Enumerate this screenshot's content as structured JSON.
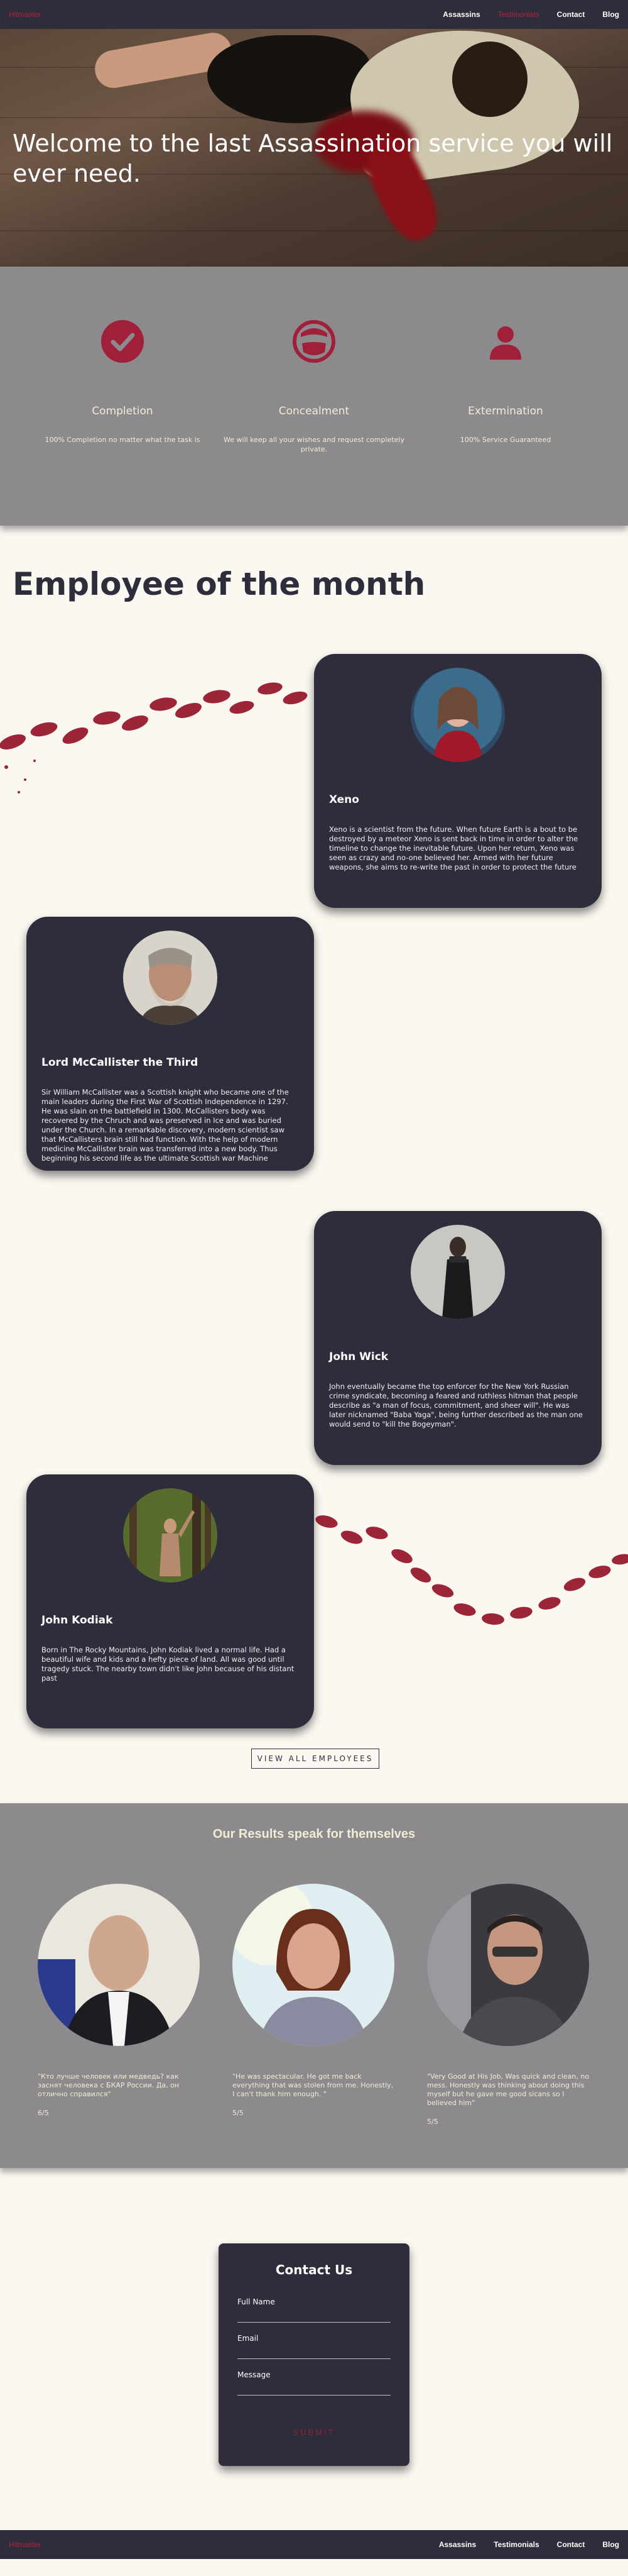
{
  "nav": {
    "brand": "Hitmaster",
    "links": [
      {
        "label": "Assassins"
      },
      {
        "label": "Testimonials"
      },
      {
        "label": "Contact"
      },
      {
        "label": "Blog"
      }
    ]
  },
  "hero": {
    "title": "Welcome to the last Assassination service you will ever need."
  },
  "features": [
    {
      "icon": "checkmark-circle-icon",
      "title": "Completion",
      "description": "100% Completion no matter what the task is"
    },
    {
      "icon": "masked-face-icon",
      "title": "Concealment",
      "description": "We will keep all your wishes and request completely private."
    },
    {
      "icon": "person-icon",
      "title": "Extermination",
      "description": "100% Service Guaranteed"
    }
  ],
  "employees": {
    "title": "Employee of the month",
    "cards": [
      {
        "name": "Xeno",
        "bio": "Xeno is a scientist from the future. When future Earth is a bout to be destroyed by a meteor Xeno is sent back in time in order to alter the timeline to change the inevitable future. Upon her return, Xeno was seen as crazy and no-one believed her. Armed with her future weapons, she aims to re-write the past in order to protect the future"
      },
      {
        "name": "Lord McCallister the Third",
        "bio": "Sir William McCallister was a Scottish knight who became one of the main leaders during the First War of Scottish Independence in 1297. He was slain on the battlefield in 1300. McCallisters body was recovered by the Chruch and was preserved in Ice and was buried under the Church. In a remarkable discovery, modern scientist saw that McCallisters brain still had function. With the help of modern medicine McCallister brain was transferred into a new body. Thus beginning his second life as the ultimate Scottish war Machine"
      },
      {
        "name": "John Wick",
        "bio": "John eventually became the top enforcer for the New York Russian crime syndicate, becoming a feared and ruthless hitman that people describe as \"a man of focus, commitment, and sheer will\". He was later nicknamed \"Baba Yaga\", being further described as the man one would send to \"kill the Bogeyman\"."
      },
      {
        "name": "John Kodiak",
        "bio": "Born in The Rocky Mountains, John Kodiak lived a normal life. Had a beautiful wife and kids and a hefty piece of land. All was good until tragedy stuck. The nearby town didn't like John because of his distant past"
      }
    ],
    "view_all_label": "VIEW ALL EMPLOYEES"
  },
  "results": {
    "title": "Our Results speak for themselves",
    "testimonials": [
      {
        "quote": "\"Кто лучше человек или медведь? как заснят человека с БКАР России. Да, он отлично справился\"",
        "rating": "6/5"
      },
      {
        "quote": "\"He was spectacular. He got me back everything that was stolen from me. Honestly, I can't thank him enough. \"",
        "rating": "5/5"
      },
      {
        "quote": "\"Very Good at His Job, Was quick and clean, no mess. Honestly was thinking about doing this myself but he gave me good sicans so I believed him\"",
        "rating": "5/5"
      }
    ]
  },
  "contact": {
    "title": "Contact Us",
    "fields": [
      {
        "label": "Full Name"
      },
      {
        "label": "Email"
      },
      {
        "label": "Message"
      }
    ],
    "submit_label": "SUBMIT"
  },
  "colors": {
    "navy": "#2e2d3b",
    "accent": "#b3243c",
    "gray": "#8c8a8d",
    "cream": "#f2ecd6",
    "background": "#fbf7f1"
  }
}
